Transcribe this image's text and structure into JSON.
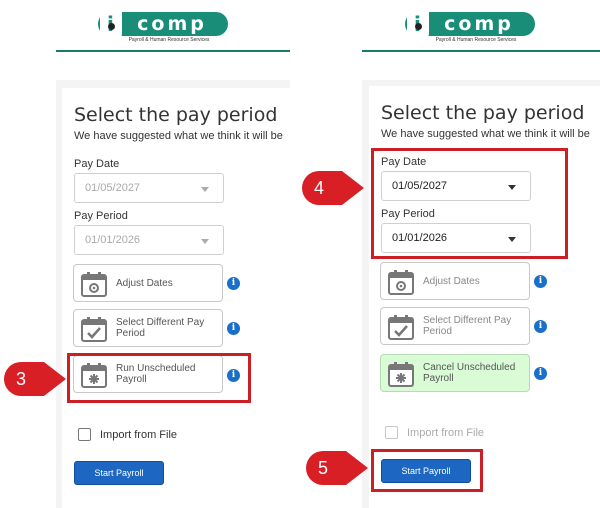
{
  "brand": {
    "logo_text": "comp",
    "logo_letter": "i",
    "tagline": "Payroll & Human Resource Services",
    "color": "#1a8d79"
  },
  "left": {
    "title": "Select the pay period",
    "subtitle": "We have suggested what we think it will be",
    "pay_date_label": "Pay Date",
    "pay_date_value": "01/05/2027",
    "pay_period_label": "Pay Period",
    "pay_period_value": "01/01/2026",
    "cards": [
      {
        "label": "Adjust Dates"
      },
      {
        "label": "Select Different Pay Period"
      },
      {
        "label": "Run Unscheduled Payroll"
      }
    ],
    "import_label": "Import from File",
    "start_button": "Start Payroll"
  },
  "right": {
    "title": "Select the pay period",
    "subtitle": "We have suggested what we think it will be",
    "pay_date_label": "Pay Date",
    "pay_date_value": "01/05/2027",
    "pay_period_label": "Pay Period",
    "pay_period_value": "01/01/2026",
    "cards": [
      {
        "label": "Adjust Dates"
      },
      {
        "label": "Select Different Pay Period"
      },
      {
        "label": "Cancel Unscheduled Payroll"
      }
    ],
    "import_label": "Import from File",
    "start_button": "Start Payroll"
  },
  "callouts": [
    "3",
    "4",
    "5"
  ],
  "colors": {
    "highlight": "#cc1f25",
    "button": "#1d66c1",
    "info": "#1a6fc9",
    "active_card": "#d9fbd6"
  }
}
